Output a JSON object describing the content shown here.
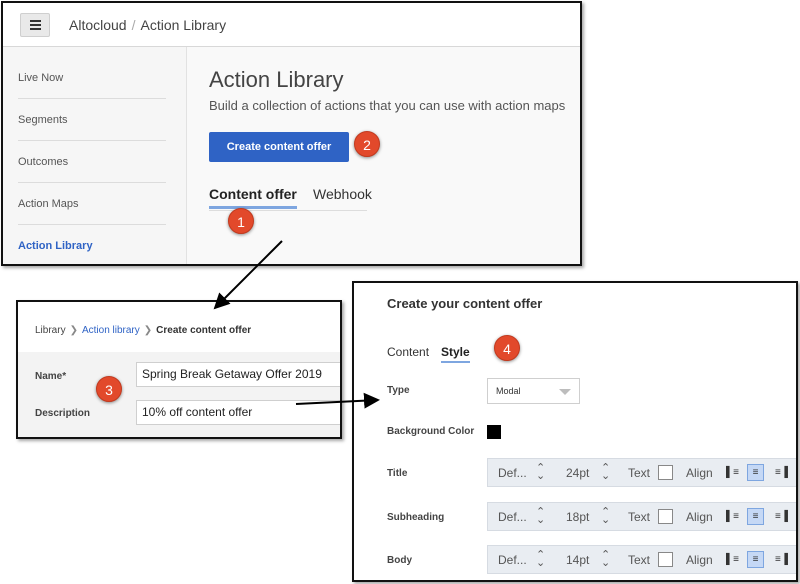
{
  "main": {
    "app_name": "Altocloud",
    "breadcrumb_current": "Action Library",
    "sidebar": [
      {
        "label": "Live Now"
      },
      {
        "label": "Segments"
      },
      {
        "label": "Outcomes"
      },
      {
        "label": "Action Maps"
      },
      {
        "label": "Action Library"
      }
    ],
    "title": "Action Library",
    "subtitle": "Build a collection of actions that you can use with action maps",
    "create_button": "Create content offer",
    "tabs": [
      "Content offer",
      "Webhook"
    ]
  },
  "callouts": [
    "1",
    "2",
    "3",
    "4"
  ],
  "form": {
    "breadcrumb": {
      "root": "Library",
      "link": "Action library",
      "current": "Create content offer"
    },
    "name_label": "Name*",
    "name_value": "Spring Break Getaway Offer 2019",
    "description_label": "Description",
    "description_value": "10% off content offer"
  },
  "style_panel": {
    "title": "Create your content offer",
    "tabs": {
      "content": "Content",
      "style": "Style"
    },
    "type_label": "Type",
    "type_value": "Modal",
    "bg_color_label": "Background Color",
    "bg_color": "#000000",
    "rows": [
      {
        "label": "Title",
        "font": "Def...",
        "size": "24pt",
        "text": "Text",
        "align": "Align"
      },
      {
        "label": "Subheading",
        "font": "Def...",
        "size": "18pt",
        "text": "Text",
        "align": "Align"
      },
      {
        "label": "Body",
        "font": "Def...",
        "size": "14pt",
        "text": "Text",
        "align": "Align"
      }
    ]
  },
  "colors": {
    "accent": "#2f63c5",
    "callout": "#e2492b",
    "tab_underline": "#7ea6e0"
  }
}
